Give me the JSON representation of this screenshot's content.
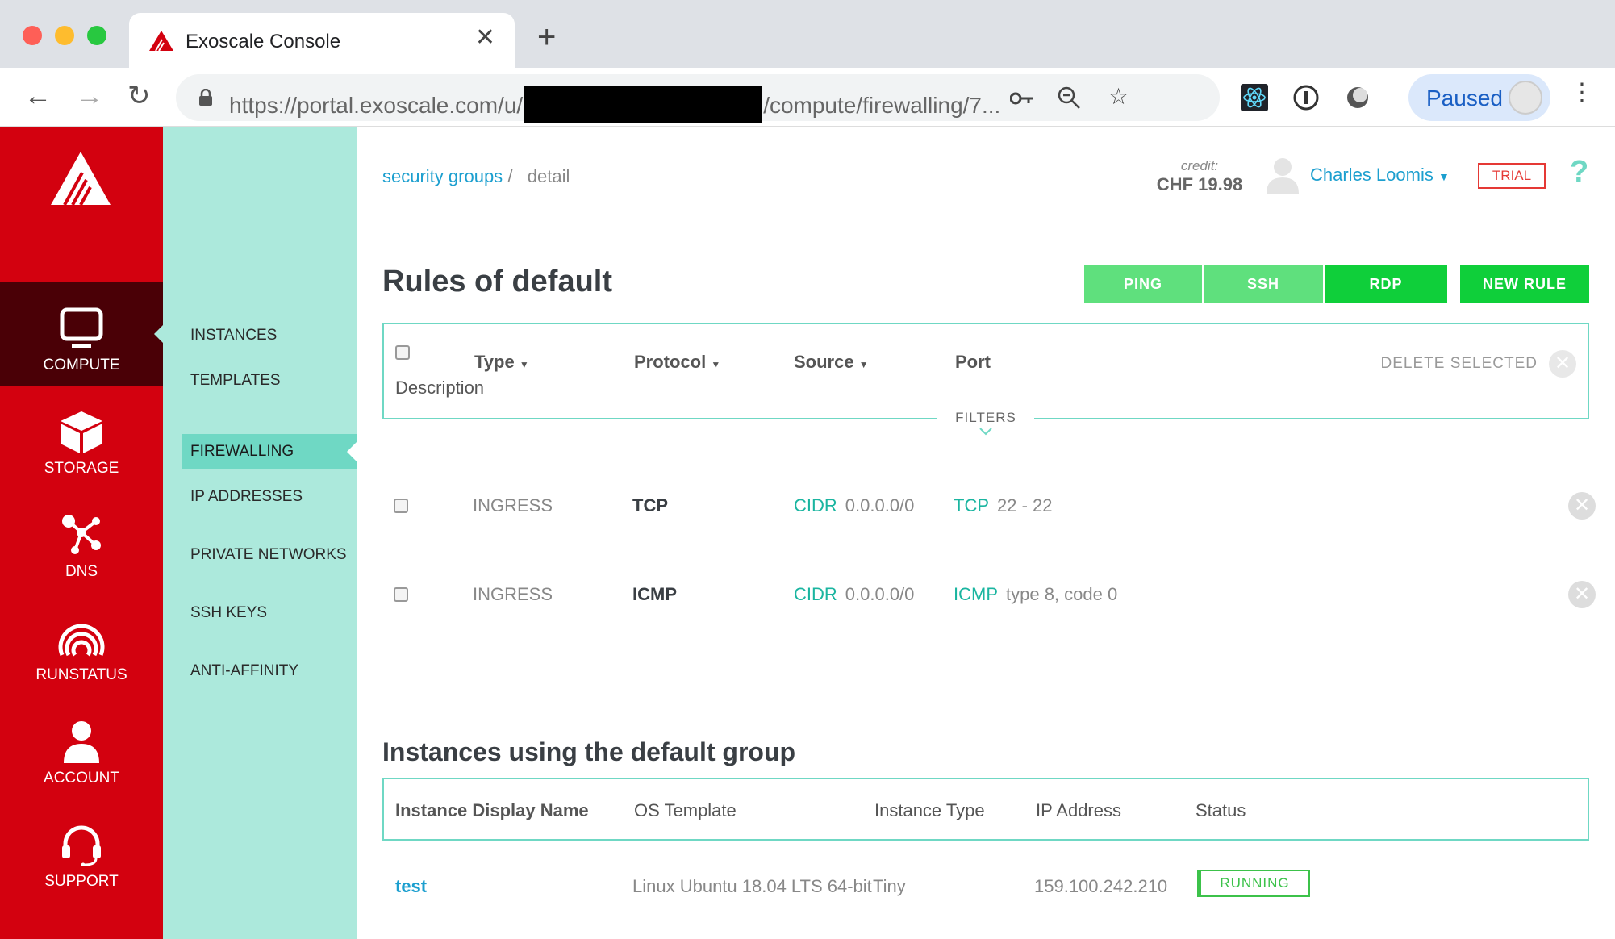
{
  "browser": {
    "tab_title": "Exoscale Console",
    "url_prefix": "https://portal.exoscale.com/u/",
    "url_suffix": "/compute/firewalling/7...",
    "profile_label": "Paused"
  },
  "sidebar": {
    "items": [
      {
        "label": "COMPUTE",
        "icon": "monitor-icon"
      },
      {
        "label": "STORAGE",
        "icon": "cube-icon"
      },
      {
        "label": "DNS",
        "icon": "nodes-icon"
      },
      {
        "label": "RUNSTATUS",
        "icon": "signal-icon"
      },
      {
        "label": "ACCOUNT",
        "icon": "user-icon"
      },
      {
        "label": "SUPPORT",
        "icon": "headset-icon"
      }
    ]
  },
  "subnav": {
    "items": [
      {
        "label": "INSTANCES"
      },
      {
        "label": "TEMPLATES"
      },
      {
        "label": "FIREWALLING"
      },
      {
        "label": "IP ADDRESSES"
      },
      {
        "label": "PRIVATE NETWORKS"
      },
      {
        "label": "SSH KEYS"
      },
      {
        "label": "ANTI-AFFINITY"
      }
    ]
  },
  "header": {
    "breadcrumb_link": "security groups",
    "breadcrumb_sep": "/",
    "breadcrumb_current": "detail",
    "credit_label": "credit:",
    "credit_value": "CHF 19.98",
    "user_name": "Charles Loomis",
    "trial_badge": "TRIAL",
    "help": "?"
  },
  "rules": {
    "title": "Rules of default",
    "buttons": {
      "ping": "PING",
      "ssh": "SSH",
      "rdp": "RDP",
      "new_rule": "NEW RULE"
    },
    "columns": {
      "type": "Type",
      "protocol": "Protocol",
      "source": "Source",
      "port": "Port",
      "description": "Description"
    },
    "delete_selected": "DELETE SELECTED",
    "filters": "FILTERS",
    "rows": [
      {
        "type": "INGRESS",
        "protocol": "TCP",
        "source_kind": "CIDR",
        "source": "0.0.0.0/0",
        "port_kind": "TCP",
        "port": "22 - 22"
      },
      {
        "type": "INGRESS",
        "protocol": "ICMP",
        "source_kind": "CIDR",
        "source": "0.0.0.0/0",
        "port_kind": "ICMP",
        "port": "type 8, code 0"
      }
    ]
  },
  "instances": {
    "title": "Instances using the default group",
    "columns": {
      "name": "Instance Display Name",
      "os": "OS Template",
      "type": "Instance Type",
      "ip": "IP Address",
      "status": "Status"
    },
    "rows": [
      {
        "name": "test",
        "os": "Linux Ubuntu 18.04 LTS 64-bit",
        "type": "Tiny",
        "ip": "159.100.242.210",
        "status": "RUNNING"
      }
    ]
  }
}
